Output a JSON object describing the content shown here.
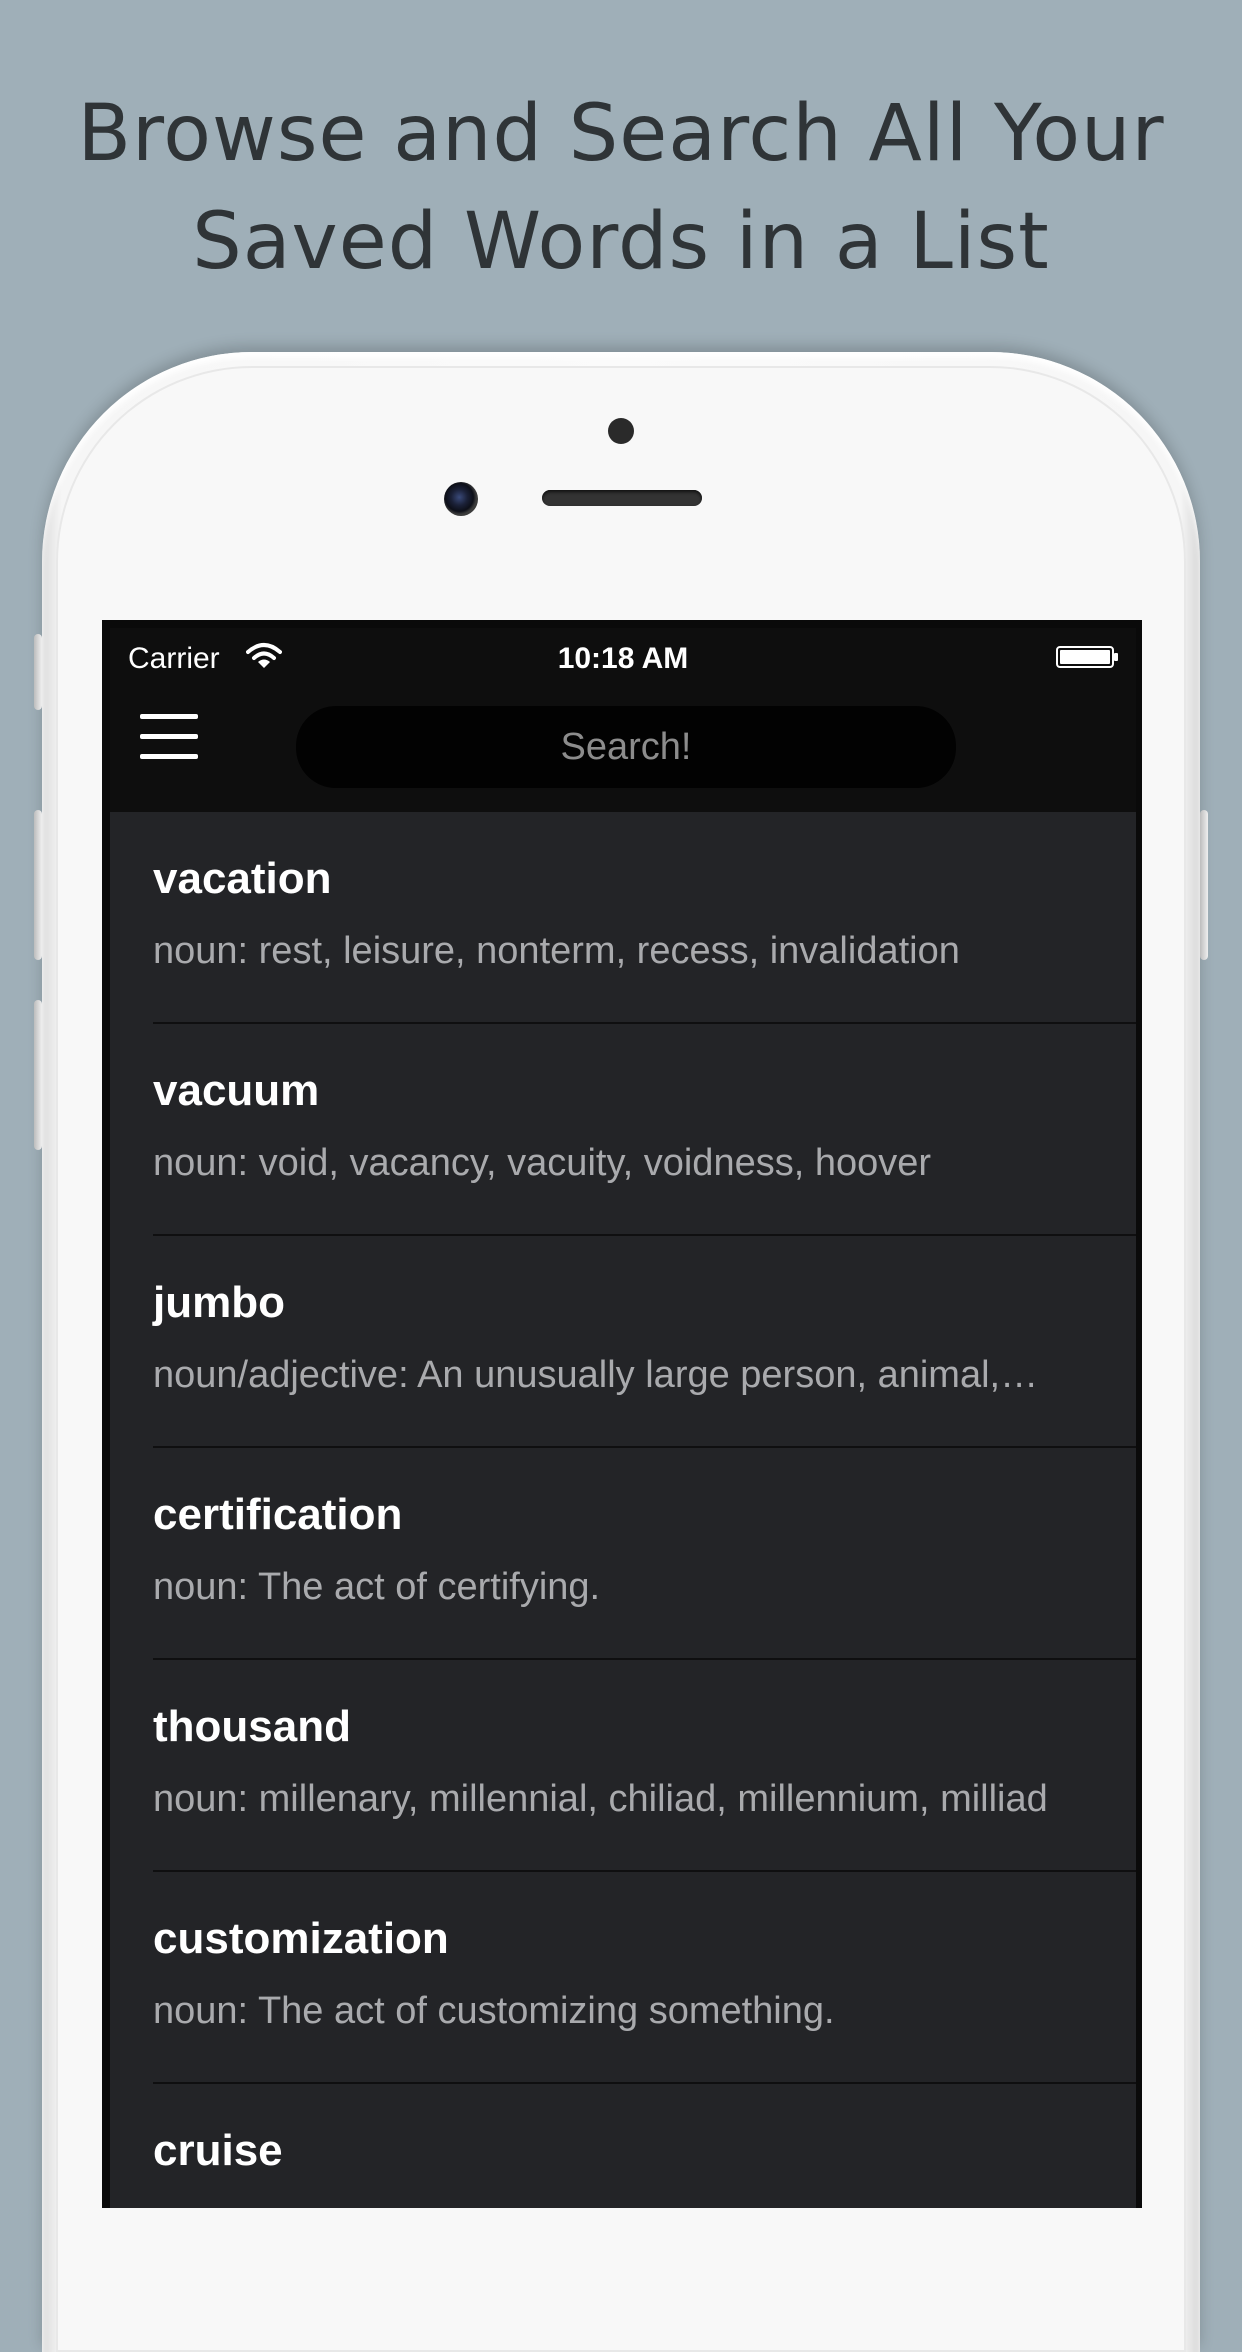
{
  "headline": {
    "line1": "Browse and Search All Your",
    "line2": "Saved Words in a List"
  },
  "status_bar": {
    "carrier": "Carrier",
    "time": "10:18 AM",
    "wifi_icon": "wifi-icon",
    "battery_icon": "battery-icon"
  },
  "nav": {
    "menu_icon": "hamburger-menu-icon",
    "search_placeholder": "Search!",
    "search_value": ""
  },
  "words": [
    {
      "word": "vacation",
      "definition": "noun: rest, leisure, nonterm, recess, invalidation"
    },
    {
      "word": "vacuum",
      "definition": "noun: void, vacancy, vacuity, voidness, hoover"
    },
    {
      "word": "jumbo",
      "definition": "noun/adjective: An unusually large person, animal,…"
    },
    {
      "word": "certification",
      "definition": "noun: The act of certifying."
    },
    {
      "word": "thousand",
      "definition": "noun: millenary, millennial, chiliad, millennium, milliad"
    },
    {
      "word": "customization",
      "definition": "noun: The act of customizing something."
    },
    {
      "word": "cruise",
      "definition": ""
    }
  ],
  "colors": {
    "background": "#9fafb8",
    "list_background": "#232427",
    "navbar": "#0e0e0e",
    "word_text": "#ffffff",
    "definition_text": "#a9aaad"
  }
}
